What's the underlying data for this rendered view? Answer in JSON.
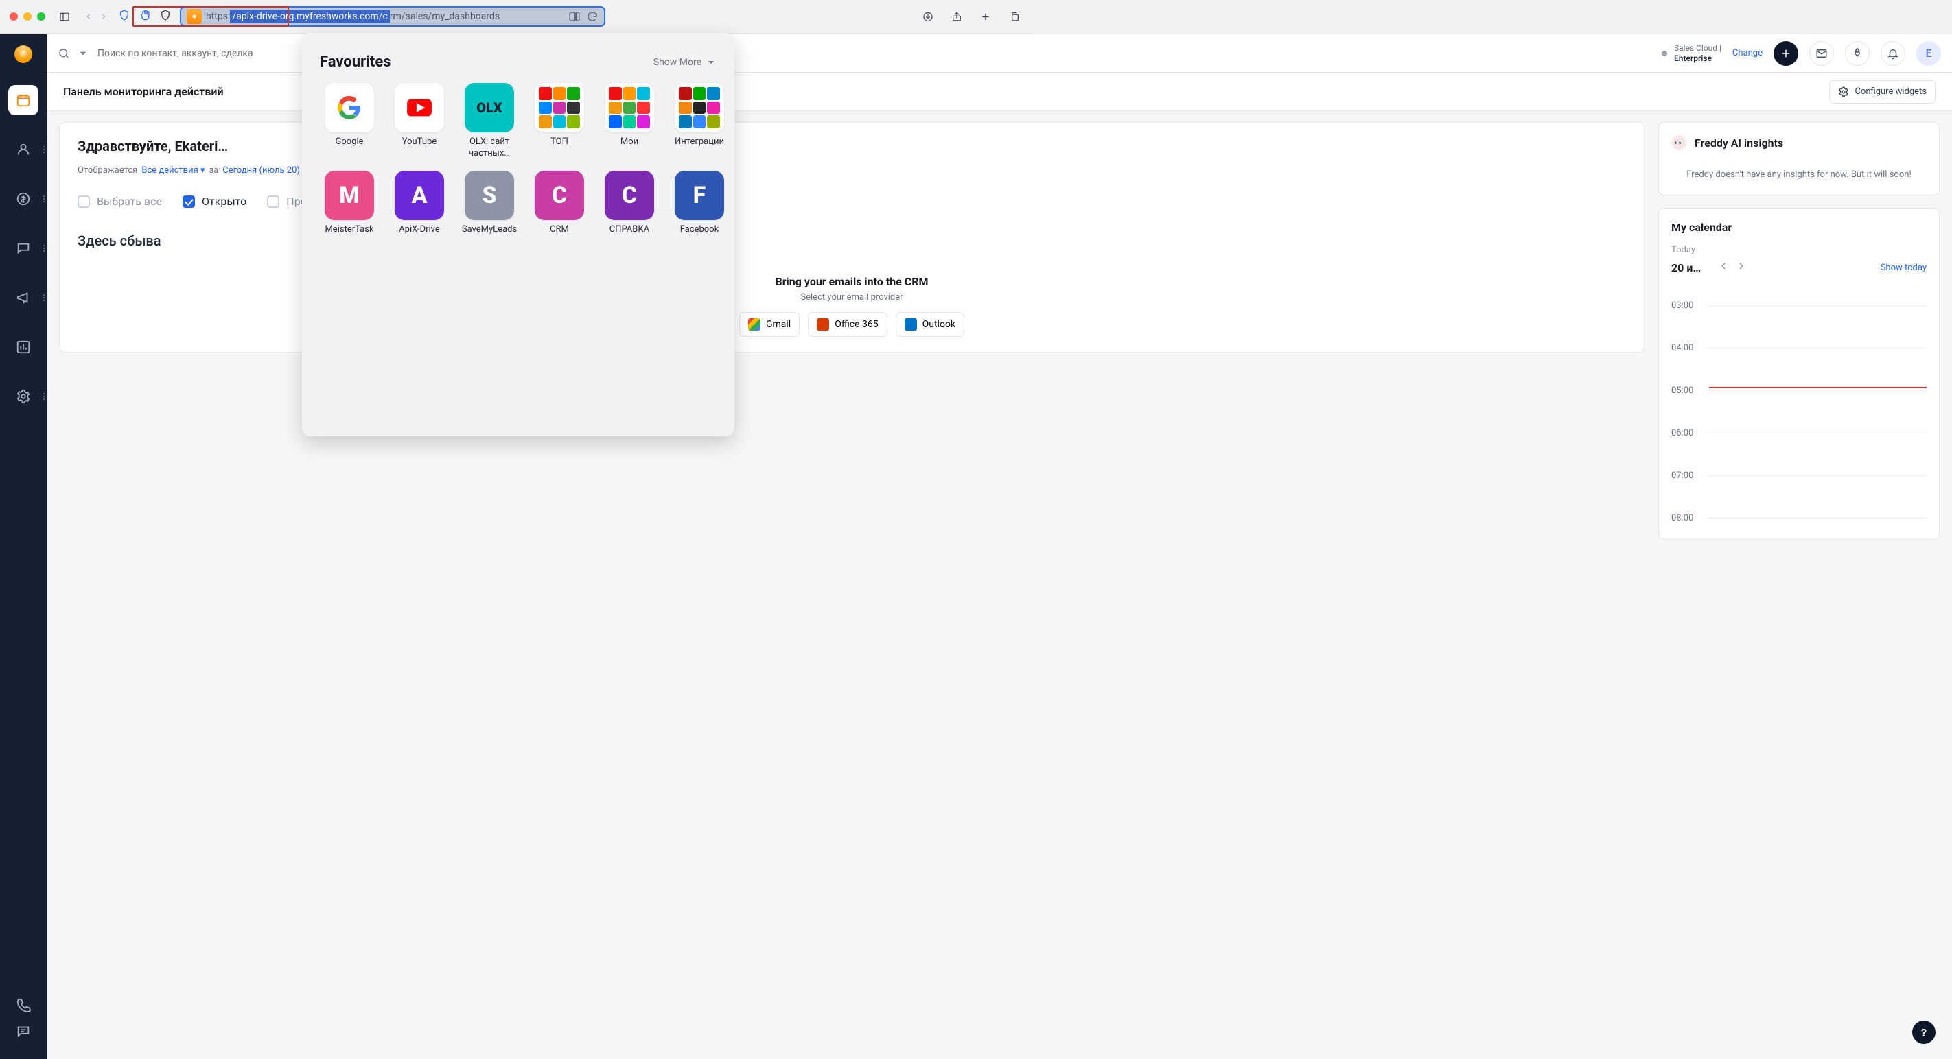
{
  "url": {
    "scheme": "https:",
    "selected": "/apix-drive-org.myfreshworks.com/c",
    "rest": "rm/sales/my_dashboards"
  },
  "favourites": {
    "title": "Favourites",
    "show_more": "Show More",
    "items": [
      {
        "label": "Google",
        "kind": "google",
        "letter": ""
      },
      {
        "label": "YouTube",
        "kind": "yt",
        "letter": ""
      },
      {
        "label": "OLX: сайт частных…",
        "kind": "olx",
        "letter": ""
      },
      {
        "label": "ТОП",
        "kind": "grid",
        "letter": ""
      },
      {
        "label": "Мои",
        "kind": "grid",
        "letter": ""
      },
      {
        "label": "Интеграции",
        "kind": "grid",
        "letter": ""
      },
      {
        "label": "MeisterTask",
        "kind": "m",
        "letter": "M"
      },
      {
        "label": "ApiX-Drive",
        "kind": "a",
        "letter": "A"
      },
      {
        "label": "SaveMyLeads",
        "kind": "s",
        "letter": "S"
      },
      {
        "label": "CRM",
        "kind": "c",
        "letter": "C"
      },
      {
        "label": "СПРАВКА",
        "kind": "c2",
        "letter": "C"
      },
      {
        "label": "Facebook",
        "kind": "f",
        "letter": "F"
      }
    ]
  },
  "search": {
    "placeholder": "Поиск по контакт, аккаунт, сделка"
  },
  "plan": {
    "line1": "Sales Cloud |",
    "line2": "Enterprise",
    "change": "Change"
  },
  "avatar": {
    "letter": "E"
  },
  "sub": {
    "title": "Панель мониторинга действий",
    "configure": "Configure widgets"
  },
  "hero": {
    "hi": "Здравствуйте, Ekateri…",
    "filter_label": "Отображается",
    "filter_value": "Все действия",
    "for_label": "за",
    "for_value": "Сегодня (июль 20)",
    "chip_all": "Выбрать все",
    "chip_open": "Открыто",
    "chip_over": "Просроче",
    "big": "Здесь сбыва",
    "emails_title": "Bring your emails into the CRM",
    "emails_sub": "Select your email provider",
    "gmail": "Gmail",
    "office": "Office 365",
    "outlook": "Outlook"
  },
  "freddy": {
    "title": "Freddy AI insights",
    "msg": "Freddy doesn't have any insights for now. But it will soon!"
  },
  "cal": {
    "title": "My calendar",
    "today": "Today",
    "date": "20 и…",
    "show": "Show today",
    "slots": [
      "03:00",
      "04:00",
      "05:00",
      "06:00",
      "07:00",
      "08:00"
    ]
  },
  "help": "?"
}
